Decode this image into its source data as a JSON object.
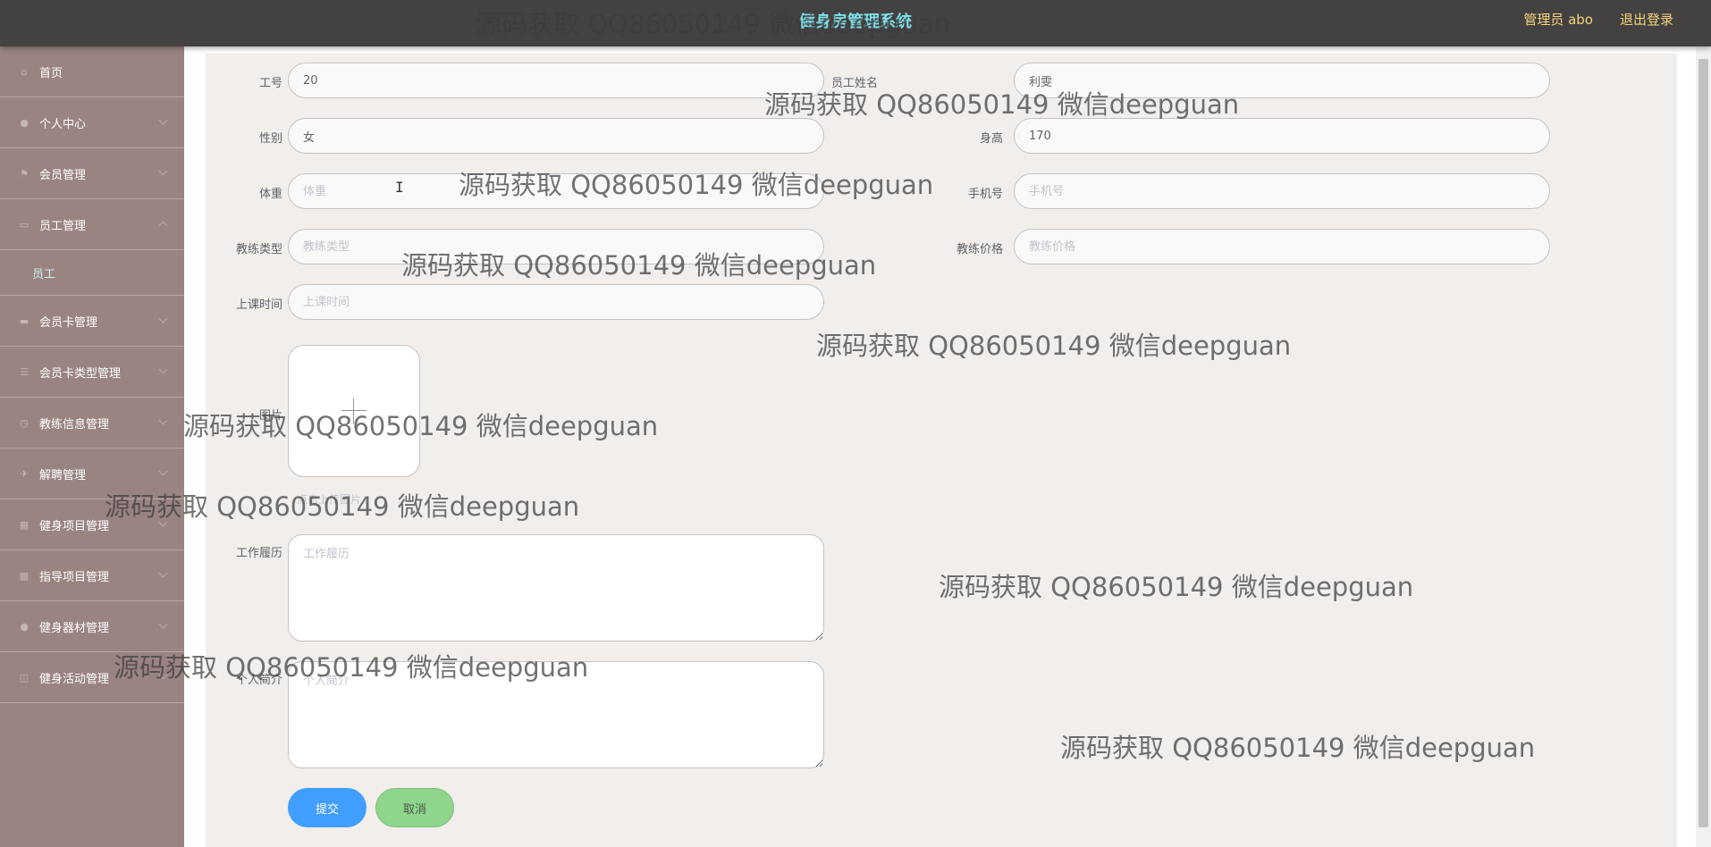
{
  "header": {
    "title": "健身房管理系统",
    "user": "管理员 abo",
    "logout": "退出登录"
  },
  "sidebar": {
    "items": [
      {
        "label": "首页",
        "icon": "home-icon"
      },
      {
        "label": "个人中心",
        "icon": "user-icon"
      },
      {
        "label": "会员管理",
        "icon": "flag-icon"
      },
      {
        "label": "员工管理",
        "icon": "monitor-icon",
        "expanded": true
      },
      {
        "label": "会员卡管理",
        "icon": "car-icon"
      },
      {
        "label": "会员卡类型管理",
        "icon": "list-icon"
      },
      {
        "label": "教练信息管理",
        "icon": "clock-icon"
      },
      {
        "label": "解聘管理",
        "icon": "plane-icon"
      },
      {
        "label": "健身项目管理",
        "icon": "grid-icon"
      },
      {
        "label": "指导项目管理",
        "icon": "grid-icon"
      },
      {
        "label": "健身器材管理",
        "icon": "user-icon"
      },
      {
        "label": "健身活动管理",
        "icon": "database-icon"
      }
    ],
    "submenu": {
      "label": "员工"
    }
  },
  "form": {
    "gonghao": {
      "label": "工号",
      "value": "20"
    },
    "yuangongxingming": {
      "label": "员工姓名",
      "value": "利雯"
    },
    "xingbie": {
      "label": "性别",
      "value": "女"
    },
    "shengao": {
      "label": "身高",
      "value": "170"
    },
    "tizhong": {
      "label": "体重",
      "placeholder": "体重"
    },
    "shoujihao": {
      "label": "手机号",
      "placeholder": "手机号"
    },
    "jiaolianleixing": {
      "label": "教练类型",
      "placeholder": "教练类型"
    },
    "jiaolianjiage": {
      "label": "教练价格",
      "placeholder": "教练价格"
    },
    "shangkeshijian": {
      "label": "上课时间",
      "placeholder": "上课时间"
    },
    "tupian": {
      "label": "图片",
      "tip": "点击上传图片"
    },
    "gongzuolvli": {
      "label": "工作履历",
      "placeholder": "工作履历"
    },
    "gerenjianjie": {
      "label": "个人简介",
      "placeholder": "个人简介"
    },
    "submit": "提交",
    "cancel": "取消"
  },
  "watermark": "源码获取 QQ86050149 微信deepguan"
}
